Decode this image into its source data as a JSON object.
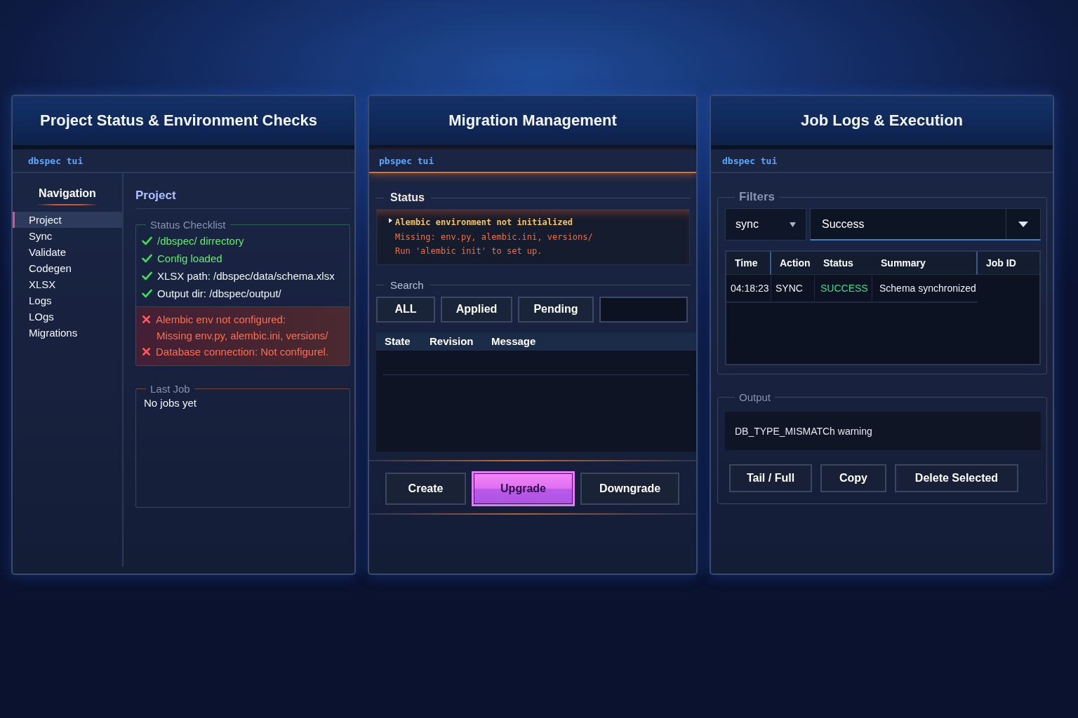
{
  "project_panel": {
    "title": "Project Status & Environment Checks",
    "app_label": "dbspec tui",
    "navigation": {
      "heading": "Navigation",
      "items": [
        {
          "label": "Project",
          "selected": true
        },
        {
          "label": "Sync",
          "selected": false
        },
        {
          "label": "Validate",
          "selected": false
        },
        {
          "label": "Codegen",
          "selected": false
        },
        {
          "label": "XLSX",
          "selected": false
        },
        {
          "label": "Logs",
          "selected": false
        },
        {
          "label": "LOgs",
          "selected": false
        },
        {
          "label": "Migrations",
          "selected": false
        }
      ]
    },
    "section_title": "Project",
    "checklist": {
      "legend": "Status Checklist",
      "items": [
        {
          "kind": "pass",
          "text": "/dbspec/ dirrectory"
        },
        {
          "kind": "pass",
          "text": "Config loaded"
        },
        {
          "kind": "info",
          "text": "XLSX path: /dbspec/data/schema.xlsx"
        },
        {
          "kind": "info",
          "text": "Output dir: /dbspec/output/"
        },
        {
          "kind": "fail",
          "text": "Alembic env not configured:",
          "detail": "Missing env.py, alembic.ini, versions/"
        },
        {
          "kind": "fail",
          "text": "Database connection: Not configurel."
        }
      ]
    },
    "last_job": {
      "legend": "Last Job",
      "text": "No jobs yet"
    }
  },
  "migration_panel": {
    "title": "Migration Management",
    "app_label": "pbspec tui",
    "status": {
      "legend": "Status",
      "lines": [
        {
          "kind": "headline",
          "text": "Alembic environment not initialized"
        },
        {
          "kind": "error",
          "text": "Missing: env.py, alembic.ini, versions/"
        },
        {
          "kind": "error",
          "text": "Run 'alembic init' to set up."
        }
      ]
    },
    "search": {
      "legend": "Search",
      "filters": [
        "ALL",
        "Applied",
        "Pending"
      ]
    },
    "table": {
      "columns": [
        "State",
        "Revision",
        "Message"
      ]
    },
    "actions": [
      {
        "label": "Create",
        "kind": "default"
      },
      {
        "label": "Upgrade",
        "kind": "primary"
      },
      {
        "label": "Downgrade",
        "kind": "default"
      }
    ]
  },
  "job_logs_panel": {
    "title": "Job Logs & Execution",
    "app_label": "dbspec tui",
    "filters": {
      "legend": "Filters",
      "action": "sync",
      "status": "Success"
    },
    "table": {
      "columns": [
        "Time",
        "Action",
        "Status",
        "Summary",
        "Job ID"
      ],
      "rows": [
        {
          "time": "04:18:23",
          "action": "SYNC",
          "status": "SUCCESS",
          "color": "#3ddc97",
          "summary": "Schema synchronized"
        }
      ]
    },
    "output": {
      "legend": "Output",
      "text": "DB_TYPE_MISMATCh warning"
    },
    "actions": [
      "Tail / Full",
      "Copy",
      "Delete Selected"
    ]
  }
}
